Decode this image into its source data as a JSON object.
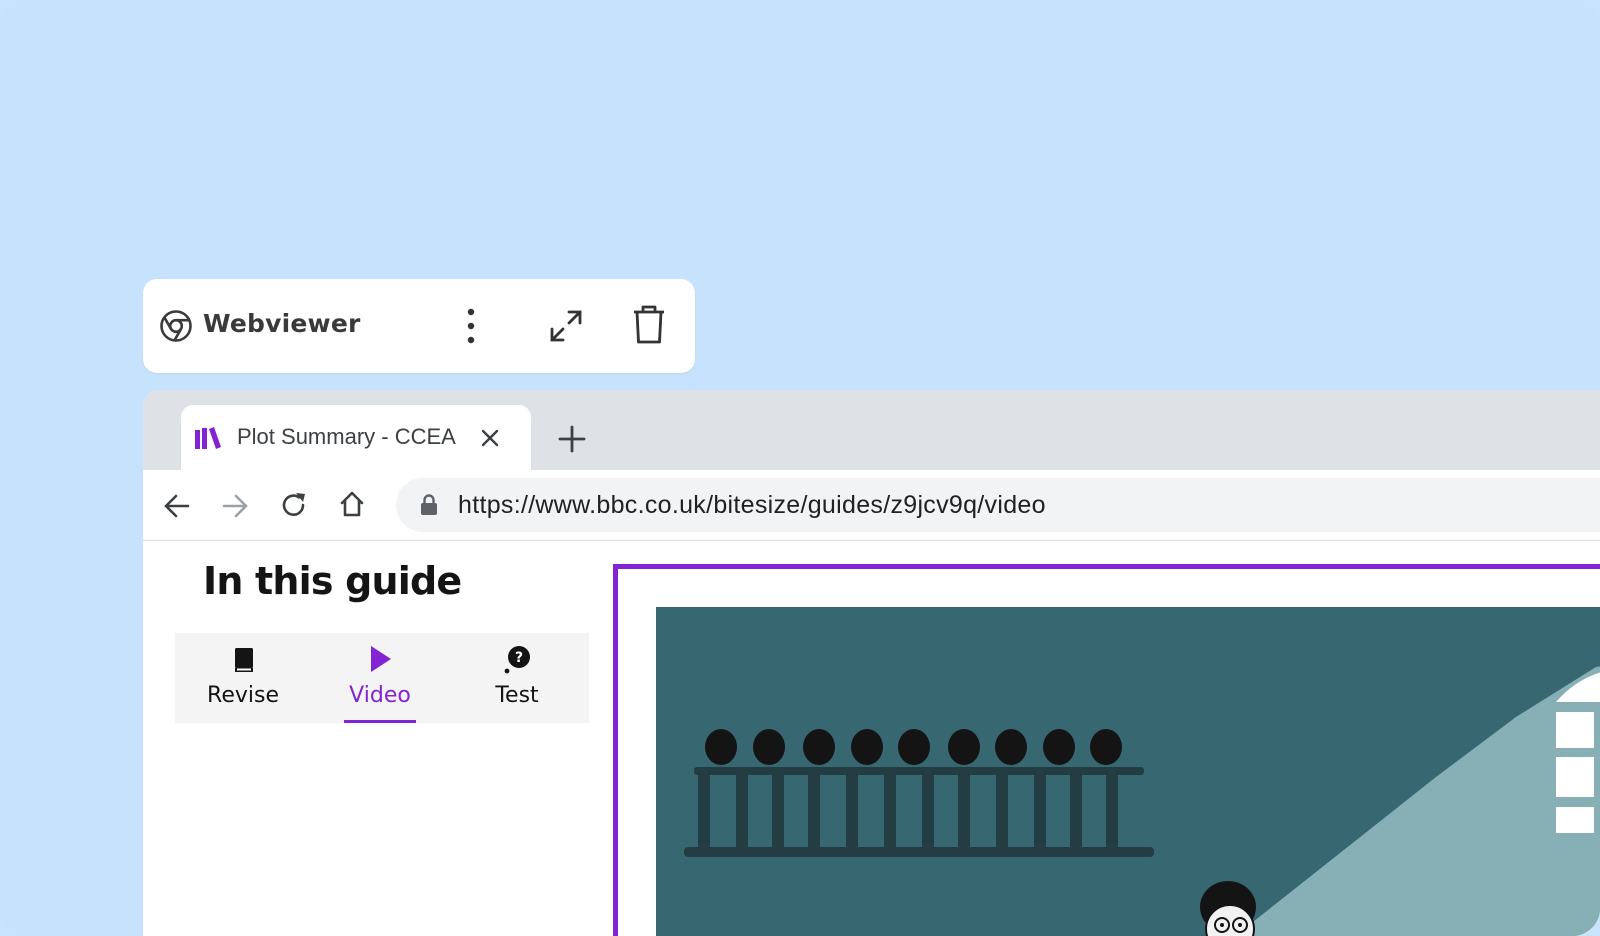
{
  "webviewer": {
    "title": "Webviewer",
    "icons": [
      "chrome-icon",
      "more-vert-icon",
      "expand-icon",
      "trash-icon"
    ]
  },
  "browser": {
    "tab": {
      "title": "Plot Summary - CCEA",
      "favicon": "bitesize-books-icon"
    },
    "toolbar": {
      "url": "https://www.bbc.co.uk/bitesize/guides/z9jcv9q/video"
    }
  },
  "page": {
    "guide_heading": "In this guide",
    "guide_tabs": [
      {
        "label": "Revise",
        "icon": "book-icon",
        "active": false
      },
      {
        "label": "Video",
        "icon": "play-icon",
        "active": true
      },
      {
        "label": "Test",
        "icon": "question-bubble-icon",
        "active": false
      }
    ]
  },
  "colors": {
    "background": "#c6e2fd",
    "accent": "#8324d4",
    "video_bg": "#376771",
    "video_light": "#86b0b6"
  }
}
